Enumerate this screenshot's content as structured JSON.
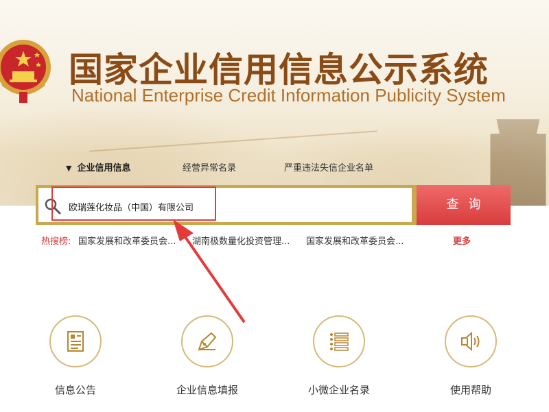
{
  "header": {
    "title_cn": "国家企业信用信息公示系统",
    "title_en": "National Enterprise Credit Information Publicity System"
  },
  "nav": {
    "tabs": [
      {
        "label": "企业信用信息",
        "active": true
      },
      {
        "label": "经营异常名录",
        "active": false
      },
      {
        "label": "严重违法失信企业名单",
        "active": false
      }
    ]
  },
  "search": {
    "value": "欧瑞莲化妆品（中国）有限公司",
    "button_label": "查询"
  },
  "hot": {
    "label": "热搜榜:",
    "items": [
      "国家发展和改革委员会...",
      "湖南极数量化投资管理...",
      "国家发展和改革委员会..."
    ],
    "more_label": "更多"
  },
  "features": [
    {
      "label": "信息公告",
      "icon": "document-icon"
    },
    {
      "label": "企业信息填报",
      "icon": "pen-icon"
    },
    {
      "label": "小微企业名录",
      "icon": "list-icon"
    },
    {
      "label": "使用帮助",
      "icon": "speaker-icon"
    }
  ],
  "colors": {
    "brand_brown": "#8a4b16",
    "gold": "#c9a84f",
    "red": "#d93c3c",
    "circle_border": "#d8b878"
  }
}
